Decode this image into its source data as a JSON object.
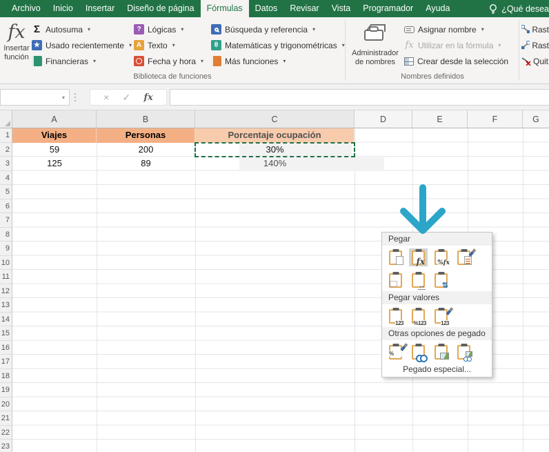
{
  "tabs": {
    "items": [
      {
        "label": "Archivo"
      },
      {
        "label": "Inicio"
      },
      {
        "label": "Insertar"
      },
      {
        "label": "Diseño de página"
      },
      {
        "label": "Fórmulas",
        "active": true
      },
      {
        "label": "Datos"
      },
      {
        "label": "Revisar"
      },
      {
        "label": "Vista"
      },
      {
        "label": "Programador"
      },
      {
        "label": "Ayuda"
      }
    ],
    "search": "¿Qué desea"
  },
  "ribbon": {
    "insert_function": {
      "line1": "Insertar",
      "line2": "función",
      "glyph": "fx"
    },
    "library": {
      "col1": [
        {
          "label": "Autosuma",
          "glyph": "Σ",
          "icon": "autosum-sigma-icon"
        },
        {
          "label": "Usado recientemente",
          "glyph": "★",
          "icon": "recently-used-icon"
        },
        {
          "label": "Financieras",
          "glyph": "",
          "icon": "financial-book-icon"
        }
      ],
      "col2": [
        {
          "label": "Lógicas",
          "glyph": "?",
          "icon": "logical-icon"
        },
        {
          "label": "Texto",
          "glyph": "A",
          "icon": "text-icon"
        },
        {
          "label": "Fecha y hora",
          "glyph": "",
          "icon": "date-time-clock-icon"
        }
      ],
      "col3": [
        {
          "label": "Búsqueda y referencia",
          "glyph": "",
          "icon": "lookup-reference-icon"
        },
        {
          "label": "Matemáticas y trigonométricas",
          "glyph": "θ",
          "icon": "math-trig-icon"
        },
        {
          "label": "Más funciones",
          "glyph": "",
          "icon": "more-functions-book-icon"
        }
      ],
      "group_label": "Biblioteca de funciones"
    },
    "names": {
      "manager_line1": "Administrador",
      "manager_line2": "de nombres",
      "items": [
        {
          "label": "Asignar nombre"
        },
        {
          "label": "Utilizar en la fórmula",
          "disabled": true
        },
        {
          "label": "Crear desde la selección"
        }
      ],
      "group_label": "Nombres definidos"
    },
    "audit": {
      "items": [
        {
          "label": "Rast"
        },
        {
          "label": "Rast"
        },
        {
          "label": "Quit"
        }
      ]
    }
  },
  "formula_bar": {
    "name_box": "",
    "cancel_glyph": "×",
    "enter_glyph": "✓",
    "fx_glyph": "fx",
    "formula": ""
  },
  "sheet": {
    "col_headers": [
      "A",
      "B",
      "C",
      "D",
      "E",
      "F",
      "G"
    ],
    "row_numbers": [
      "1",
      "2",
      "3",
      "4",
      "5",
      "6",
      "7",
      "8",
      "9",
      "10",
      "11",
      "12",
      "13",
      "14",
      "15",
      "16",
      "17",
      "18",
      "19",
      "20",
      "21",
      "22",
      "23"
    ],
    "table": {
      "headers": [
        "Viajes",
        "Personas",
        "Porcentaje ocupación"
      ],
      "rows": [
        [
          "59",
          "200",
          "30%"
        ],
        [
          "125",
          "89",
          "140%"
        ]
      ]
    }
  },
  "paste_menu": {
    "sections": [
      {
        "title": "Pegar"
      },
      {
        "title": "Pegar valores"
      },
      {
        "title": "Otras opciones de pegado"
      }
    ],
    "icons": {
      "row1": [
        "pegar",
        "formulas",
        "formulas-y-formato-de-numeros",
        "mantener-formato-de-origen"
      ],
      "row2": [
        "sin-bordes",
        "mantener-ancho-de-columnas-de-origen",
        "transponer"
      ],
      "row3": [
        "valores",
        "formato-de-valores-y-numeros",
        "formato-de-valores-y-origen"
      ],
      "row4": [
        "formato",
        "pegar-vinculo",
        "imagen",
        "imagen-vinculada"
      ]
    },
    "glyphs": {
      "fx": "fx",
      "pctfx": "%fx",
      "width": "↔",
      "transpose": "⇅",
      "v123": "123",
      "p123": "%123",
      "pct": "%"
    },
    "footer": "Pegado especial..."
  },
  "colors": {
    "excel_green": "#217346",
    "header_fill_dark": "#F4B084",
    "header_fill_light": "#F8CBAD",
    "marching_ants_green": "#1E7145",
    "annotation_arrow_teal": "#2BA6C9"
  }
}
